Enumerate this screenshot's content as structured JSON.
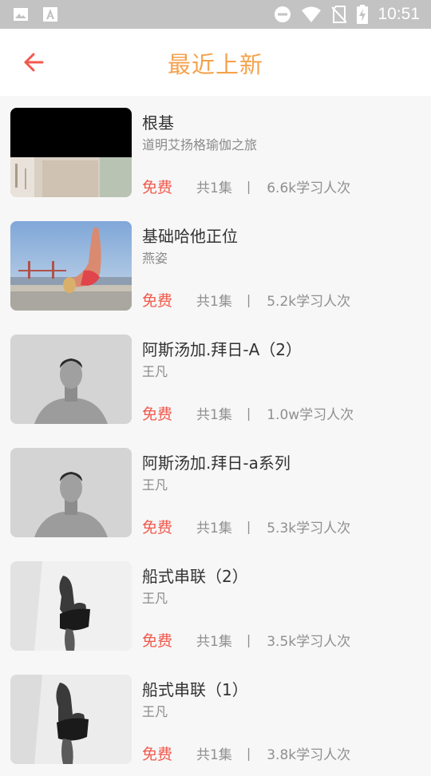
{
  "status_bar": {
    "time": "10:51",
    "left_icons": [
      "image-icon",
      "font-a-icon"
    ],
    "right_icons": [
      "dnd-icon",
      "wifi-icon",
      "no-sim-icon",
      "battery-charging-icon"
    ]
  },
  "header": {
    "back_icon": "arrow-left-icon",
    "title": "最近上新",
    "title_color": "#f5a24c",
    "accent_color": "#f2594d"
  },
  "courses": [
    {
      "title": "根基",
      "author": "道明艾扬格瑜伽之旅",
      "price": "免费",
      "episodes": "共1集",
      "divider": "|",
      "learners": "6.6k学习人次",
      "thumb": "dark-studio"
    },
    {
      "title": "基础哈他正位",
      "author": "燕姿",
      "price": "免费",
      "episodes": "共1集",
      "divider": "|",
      "learners": "5.2k学习人次",
      "thumb": "backbend-bridge"
    },
    {
      "title": "阿斯汤加.拜日-A（2）",
      "author": "王凡",
      "price": "免费",
      "episodes": "共1集",
      "divider": "|",
      "learners": "1.0w学习人次",
      "thumb": "portrait-man"
    },
    {
      "title": "阿斯汤加.拜日-a系列",
      "author": "王凡",
      "price": "免费",
      "episodes": "共1集",
      "divider": "|",
      "learners": "5.3k学习人次",
      "thumb": "portrait-man"
    },
    {
      "title": "船式串联（2）",
      "author": "王凡",
      "price": "免费",
      "episodes": "共1集",
      "divider": "|",
      "learners": "3.5k学习人次",
      "thumb": "boat-pose"
    },
    {
      "title": "船式串联（1）",
      "author": "王凡",
      "price": "免费",
      "episodes": "共1集",
      "divider": "|",
      "learners": "3.8k学习人次",
      "thumb": "boat-pose"
    }
  ]
}
